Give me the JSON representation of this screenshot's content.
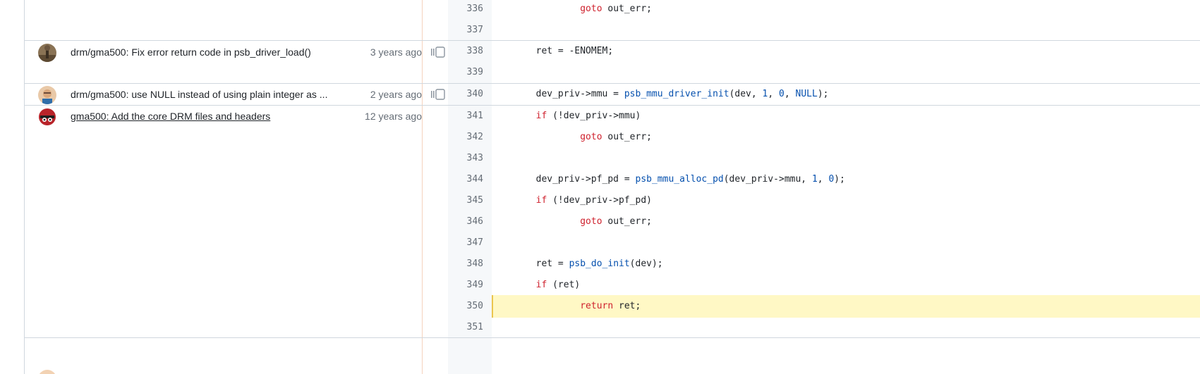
{
  "blame_groups": [
    {
      "commit_message": "drm/gma500: Fix error return code in psb_driver_load()",
      "age": "3 years ago"
    },
    {
      "commit_message": "drm/gma500: use NULL instead of using plain integer as ...",
      "age": "2 years ago"
    },
    {
      "commit_message": "gma500: Add the core DRM files and headers",
      "age": "12 years ago"
    }
  ],
  "lines": [
    {
      "num": "336",
      "pre": "                goto",
      "rest": " out_err;"
    },
    {
      "num": "337",
      "text": ""
    },
    {
      "num": "338",
      "text": "        ret = -ENOMEM;"
    },
    {
      "num": "339",
      "text": ""
    },
    {
      "num": "340",
      "text_a": "        dev_priv->mmu = ",
      "fn": "psb_mmu_driver_init",
      "text_b": "(dev, ",
      "n1": "1",
      "c1": ", ",
      "n2": "0",
      "c2": ", ",
      "n3": "NULL",
      "text_c": ");"
    },
    {
      "num": "341",
      "kw": "        if",
      "rest": " (!dev_priv->mmu)"
    },
    {
      "num": "342",
      "kw": "                goto",
      "rest": " out_err;"
    },
    {
      "num": "343",
      "text": ""
    },
    {
      "num": "344",
      "text_a": "        dev_priv->pf_pd = ",
      "fn": "psb_mmu_alloc_pd",
      "text_b": "(dev_priv->mmu, ",
      "n1": "1",
      "c1": ", ",
      "n2": "0",
      "text_c": ");"
    },
    {
      "num": "345",
      "kw": "        if",
      "rest": " (!dev_priv->pf_pd)"
    },
    {
      "num": "346",
      "kw": "                goto",
      "rest": " out_err;"
    },
    {
      "num": "347",
      "text": ""
    },
    {
      "num": "348",
      "text_a": "        ret = ",
      "fn": "psb_do_init",
      "text_b": "(dev);"
    },
    {
      "num": "349",
      "kw": "        if",
      "rest": " (ret)"
    },
    {
      "num": "350",
      "kw": "                return",
      "rest": " ret;"
    },
    {
      "num": "351",
      "text": ""
    }
  ],
  "colors": {
    "keyword": "#cf222e",
    "function": "#0550ae",
    "highlight": "#fff8c5"
  }
}
